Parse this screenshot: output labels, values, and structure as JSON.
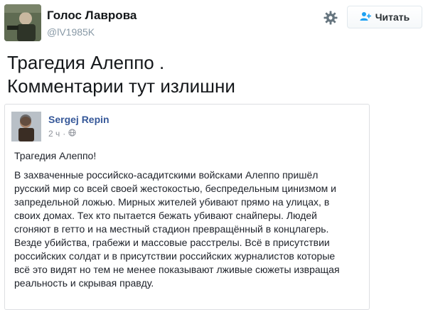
{
  "tweet": {
    "author": {
      "name": "Голос Лаврова",
      "handle": "@lV1985K"
    },
    "follow_button": {
      "label": "Читать",
      "icon": "add-user-icon"
    },
    "settings_icon": "gear-icon",
    "text_lines": [
      "Трагедия Алеппо .",
      "Комментарии тут излишни"
    ]
  },
  "facebook_post": {
    "author": "Sergej Repin",
    "time": "2 ч",
    "separator": "·",
    "privacy_icon": "globe-icon",
    "title": "Трагедия Алеппо!",
    "body_lines": [
      "В захваченные российско-асадитскими войсками Алеппо пришёл",
      "русский мир со всей своей жестокостью, беспредельным цинизмом и",
      "запредельной ложью. Мирных жителей убивают прямо на улицах, в",
      "своих домах. Тех кто пытается бежать убивают снайперы. Людей",
      "сгоняют в гетто и на местный стадион превращённый в концлагерь.",
      "Везде убийства, грабежи и массовые расстрелы. Всё в присутствии",
      "российских солдат и в присутствии российских журналистов которые",
      "всё это видят но тем не менее показывают лживые сюжеты извращая",
      "реальность и скрывая правду."
    ]
  },
  "colors": {
    "name": "#14171a",
    "handle": "#8899a6",
    "fb_link": "#365899",
    "fb_meta": "#90949c",
    "border": "#e1e8ed"
  }
}
